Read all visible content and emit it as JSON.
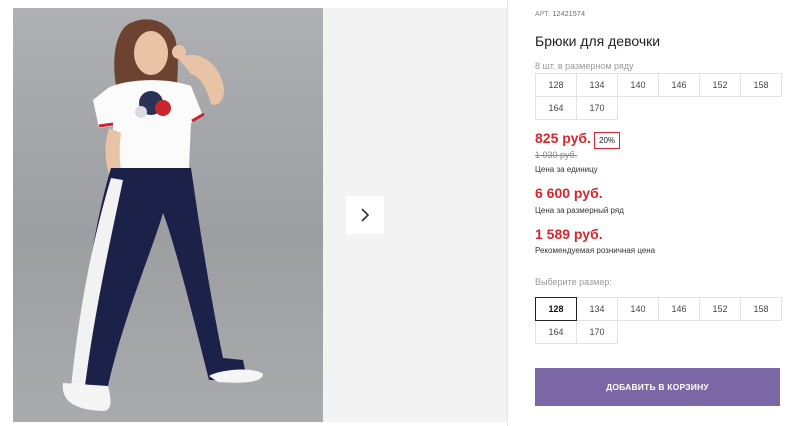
{
  "product": {
    "article_label": "АРТ.",
    "article_code": "12421574",
    "title": "Брюки для девочки"
  },
  "size_range": {
    "caption": "8 шт. в размерном ряду",
    "sizes": [
      "128",
      "134",
      "140",
      "146",
      "152",
      "158",
      "164",
      "170"
    ]
  },
  "pricing": {
    "unit_price": "825 руб.",
    "discount": "20%",
    "old_price": "1 030 руб.",
    "unit_price_caption": "Цена за единицу",
    "range_price": "6 600 руб.",
    "range_price_caption": "Цена за размерный ряд",
    "retail_price": "1 589 руб.",
    "retail_price_caption": "Рекомендуемая розничная цена"
  },
  "size_select": {
    "caption": "Выберите размер:",
    "sizes": [
      "128",
      "134",
      "140",
      "146",
      "152",
      "158",
      "164",
      "170"
    ],
    "selected": "128"
  },
  "cart": {
    "add_label": "ДОБАВИТЬ В КОРЗИНУ"
  },
  "colors": {
    "accent": "#7b67a6",
    "price": "#d5262f"
  },
  "icons": {
    "next": "chevron-right-icon"
  }
}
